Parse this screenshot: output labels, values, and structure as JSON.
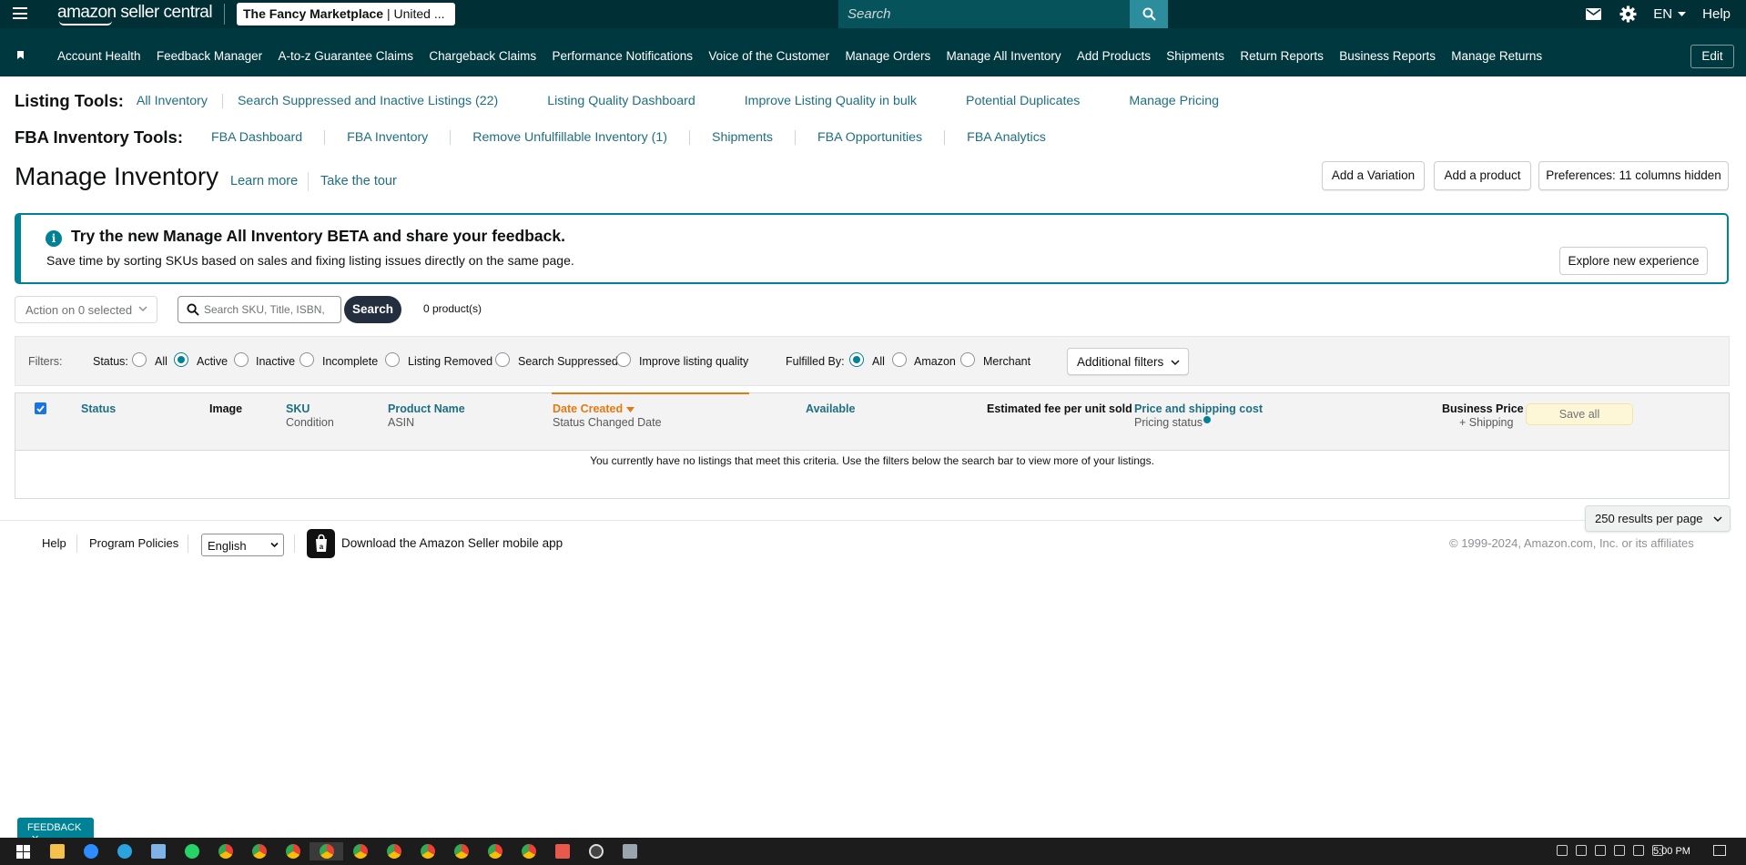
{
  "topbar": {
    "logo": "amazon seller central",
    "marketplace_bold": "The Fancy Marketplace",
    "marketplace_rest": " | United ...",
    "search_placeholder": "Search",
    "language": "EN",
    "help": "Help"
  },
  "nav": {
    "items": [
      "Account Health",
      "Feedback Manager",
      "A-to-z Guarantee Claims",
      "Chargeback Claims",
      "Performance Notifications",
      "Voice of the Customer",
      "Manage Orders",
      "Manage All Inventory",
      "Add Products",
      "Shipments",
      "Return Reports",
      "Business Reports",
      "Manage Returns"
    ],
    "edit": "Edit"
  },
  "listing_tools": {
    "title": "Listing Tools:",
    "links": [
      "All Inventory",
      "Search Suppressed and Inactive Listings (22)",
      "Listing Quality Dashboard",
      "Improve Listing Quality in bulk",
      "Potential Duplicates",
      "Manage Pricing"
    ]
  },
  "fba_tools": {
    "title": "FBA Inventory Tools:",
    "links": [
      "FBA Dashboard",
      "FBA Inventory",
      "Remove Unfulfillable Inventory (1)",
      "Shipments",
      "FBA Opportunities",
      "FBA Analytics"
    ]
  },
  "header": {
    "title": "Manage Inventory",
    "learn_more": "Learn more",
    "tour": "Take the tour",
    "add_variation": "Add a Variation",
    "add_product": "Add a product",
    "preferences": "Preferences: 11 columns hidden"
  },
  "banner": {
    "title": "Try the new Manage All Inventory BETA and share your feedback.",
    "text": "Save time by sorting SKUs based on sales and fixing listing issues directly on the same page.",
    "button": "Explore new experience"
  },
  "actions": {
    "action_select": "Action on 0 selected",
    "search_placeholder": "Search SKU, Title, ISBN,",
    "search_button": "Search",
    "count": "0 product(s)"
  },
  "filters": {
    "label": "Filters:",
    "status_label": "Status:",
    "status_options": [
      "All",
      "Active",
      "Inactive",
      "Incomplete",
      "Listing Removed",
      "Search Suppressed",
      "Improve listing quality"
    ],
    "status_selected": "Active",
    "fulfilled_label": "Fulfilled By:",
    "fulfilled_options": [
      "All",
      "Amazon",
      "Merchant"
    ],
    "fulfilled_selected": "All",
    "additional": "Additional filters"
  },
  "table": {
    "columns": {
      "status": "Status",
      "image": "Image",
      "sku": "SKU",
      "sku_sub": "Condition",
      "product": "Product Name",
      "product_sub": "ASIN",
      "date": "Date Created",
      "date_sub": "Status Changed Date",
      "available": "Available",
      "fee": "Estimated fee per unit sold",
      "price": "Price and shipping cost",
      "price_sub": "Pricing status",
      "business": "Business Price",
      "business_sub": "+ Shipping"
    },
    "save_all": "Save all",
    "empty_message": "You currently have no listings that meet this criteria. Use the filters below the search bar to view more of your listings."
  },
  "pagination": {
    "results_per_page": "250 results per page"
  },
  "footer": {
    "help": "Help",
    "policies": "Program Policies",
    "language": "English",
    "app": "Download the Amazon Seller mobile app",
    "copyright": "© 1999-2024, Amazon.com, Inc. or its affiliates"
  },
  "feedback": "FEEDBACK",
  "taskbar": {
    "time": "5:00 PM"
  },
  "colors": {
    "topbar": "#002f36",
    "navbar": "#00383f",
    "accent": "#008296",
    "link": "#1d6f82"
  }
}
